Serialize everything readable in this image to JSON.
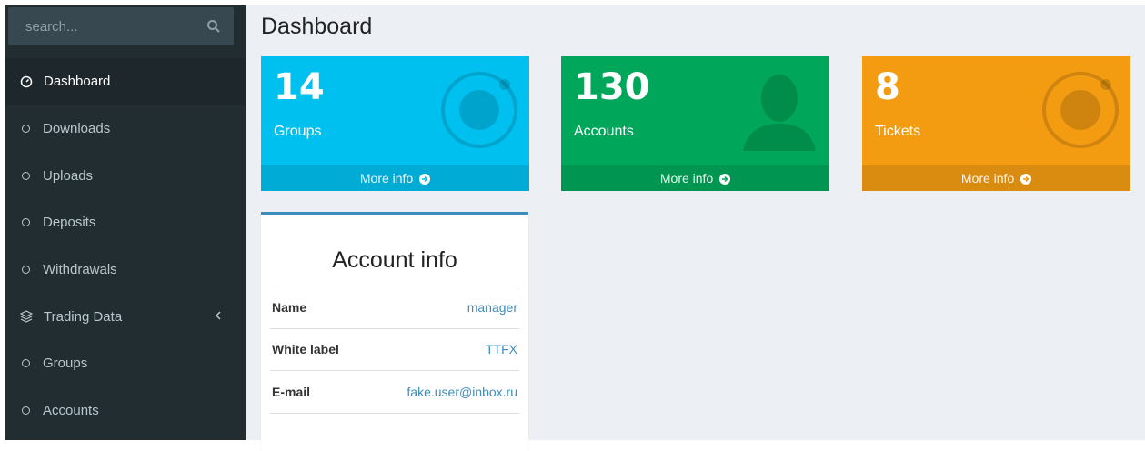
{
  "search": {
    "placeholder": "search..."
  },
  "sidebar": {
    "items": [
      {
        "label": "Dashboard",
        "icon": "dashboard-icon",
        "active": true
      },
      {
        "label": "Downloads",
        "icon": "circle-icon"
      },
      {
        "label": "Uploads",
        "icon": "circle-icon"
      },
      {
        "label": "Deposits",
        "icon": "circle-icon"
      },
      {
        "label": "Withdrawals",
        "icon": "circle-icon"
      },
      {
        "label": "Trading Data",
        "icon": "layers-icon",
        "expandable": true
      },
      {
        "label": "Groups",
        "icon": "circle-icon"
      },
      {
        "label": "Accounts",
        "icon": "circle-icon"
      }
    ]
  },
  "page": {
    "title": "Dashboard"
  },
  "boxes": [
    {
      "value": "14",
      "label": "Groups",
      "footer": "More info",
      "color": "#00c0ef",
      "icon": "ionic-icon"
    },
    {
      "value": "130",
      "label": "Accounts",
      "footer": "More info",
      "color": "#00a65a",
      "icon": "person-icon"
    },
    {
      "value": "8",
      "label": "Tickets",
      "footer": "More info",
      "color": "#f39c12",
      "icon": "ionic-icon"
    }
  ],
  "account": {
    "title": "Account info",
    "rows": [
      {
        "key": "Name",
        "value": "manager"
      },
      {
        "key": "White label",
        "value": "TTFX"
      },
      {
        "key": "E-mail",
        "value": "fake.user@inbox.ru"
      }
    ]
  },
  "colors": {
    "sidebar": "#222d32",
    "accent": "#3c8dbc",
    "content_bg": "#ecf0f5"
  }
}
